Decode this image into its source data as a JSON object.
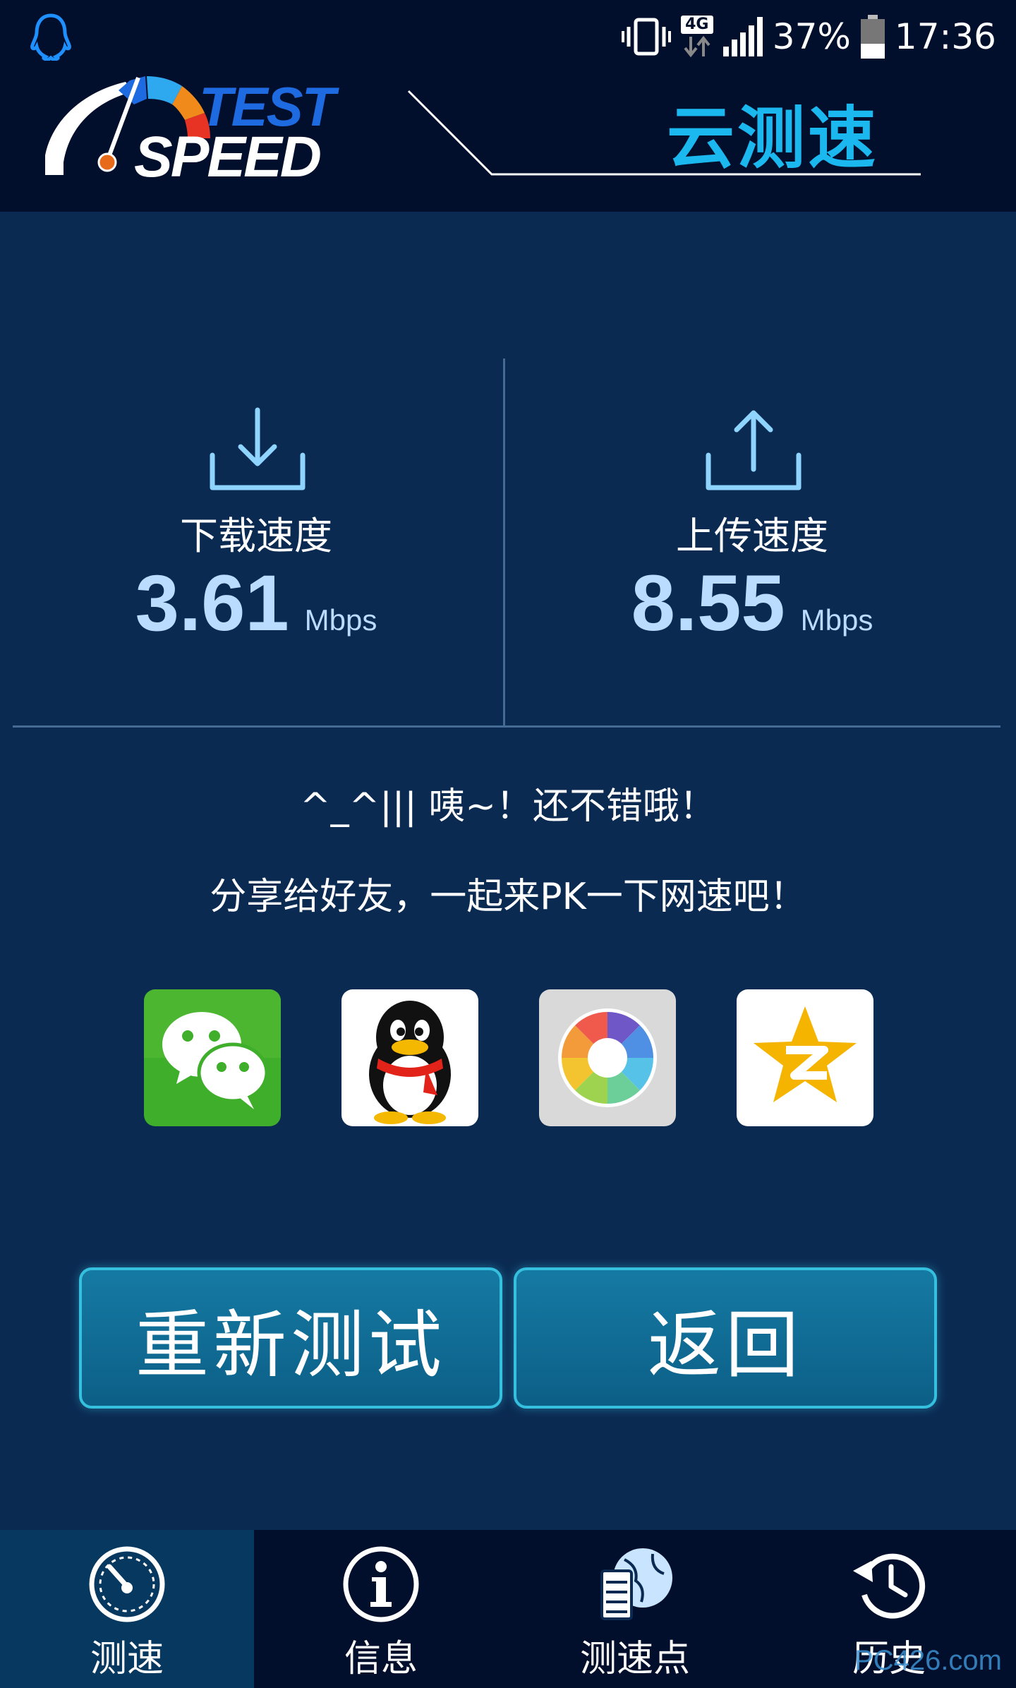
{
  "status_bar": {
    "network_type": "4G",
    "battery_percent": "37%",
    "battery_level": 0.37,
    "time": "17:36"
  },
  "header": {
    "logo_text_top": "TEST",
    "logo_text_bottom": "SPEED",
    "title": "云测速"
  },
  "results": {
    "download": {
      "label": "下载速度",
      "value": "3.61",
      "unit": "Mbps",
      "icon": "download-icon"
    },
    "upload": {
      "label": "上传速度",
      "value": "8.55",
      "unit": "Mbps",
      "icon": "upload-icon"
    }
  },
  "share": {
    "message_line1": "^_^||| 咦~！还不错哦！",
    "message_line2": "分享给好友，一起来PK一下网速吧！",
    "apps": [
      "wechat-icon",
      "qq-icon",
      "moments-icon",
      "qzone-icon"
    ]
  },
  "buttons": {
    "retest": "重新测试",
    "back": "返回"
  },
  "bottom_nav": {
    "items": [
      {
        "label": "测速",
        "icon": "speedometer-icon",
        "active": true
      },
      {
        "label": "信息",
        "icon": "info-icon",
        "active": false
      },
      {
        "label": "测速点",
        "icon": "server-globe-icon",
        "active": false
      },
      {
        "label": "历史",
        "icon": "history-icon",
        "active": false
      }
    ]
  },
  "watermark": "PC426.com",
  "colors": {
    "background": "#0b2a52",
    "header_bg": "#020f2c",
    "accent": "#1ab8ef",
    "value_color": "#b9dcff",
    "button_border": "#36c0e0"
  }
}
